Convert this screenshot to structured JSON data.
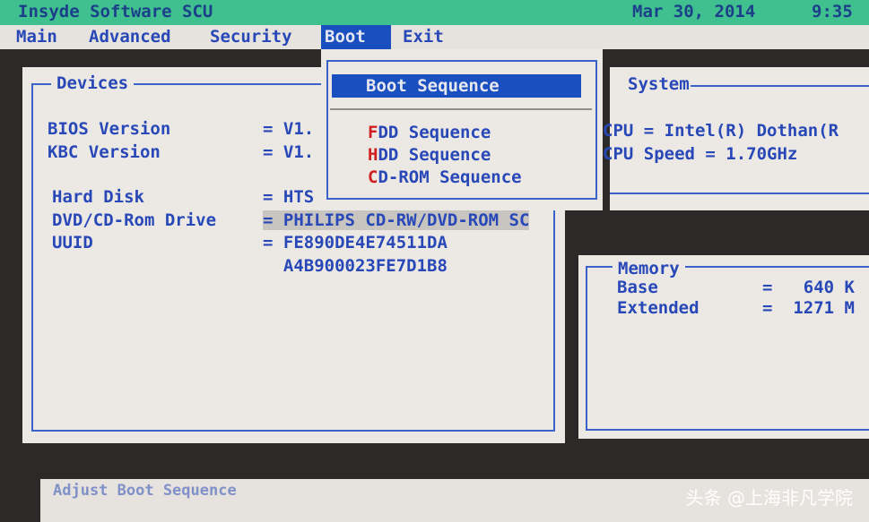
{
  "header": {
    "title": "Insyde Software SCU",
    "date": "Mar 30, 2014",
    "time": "9:35"
  },
  "menu": [
    {
      "label": "Main"
    },
    {
      "label": "Advanced"
    },
    {
      "label": "Security"
    },
    {
      "label": "Boot",
      "active": true
    },
    {
      "label": "Exit"
    }
  ],
  "devices": {
    "title": "Devices",
    "rows": [
      {
        "label": "BIOS Version",
        "value": "= V1."
      },
      {
        "label": "KBC Version",
        "value": "= V1."
      },
      {
        "label": "Hard Disk",
        "value": "= HTS"
      },
      {
        "label": "DVD/CD-Rom Drive",
        "value": "= PHILIPS CD-RW/DVD-ROM SC"
      },
      {
        "label": "UUID",
        "value": "= FE890DE4E74511DA"
      },
      {
        "label": "",
        "value": "  A4B900023FE7D1B8"
      }
    ]
  },
  "boot_menu": {
    "header": "Boot Sequence",
    "items": [
      {
        "hotkey": "F",
        "rest": "DD Sequence"
      },
      {
        "hotkey": "H",
        "rest": "DD Sequence"
      },
      {
        "hotkey": "C",
        "rest": "D-ROM Sequence"
      }
    ]
  },
  "system": {
    "title": "System",
    "rows": [
      "CPU = Intel(R) Dothan(R",
      "CPU Speed = 1.70GHz"
    ]
  },
  "memory": {
    "title": "Memory",
    "rows": [
      {
        "label": "Base",
        "value": "=   640 K"
      },
      {
        "label": "Extended",
        "value": "=  1271 M"
      }
    ]
  },
  "status": "Adjust Boot Sequence",
  "watermark": "头条 @上海非凡学院",
  "colors": {
    "header_bg": "#3fc08e",
    "accent": "#1a4fc0",
    "text": "#2848b8",
    "hotkey": "#d02020"
  }
}
